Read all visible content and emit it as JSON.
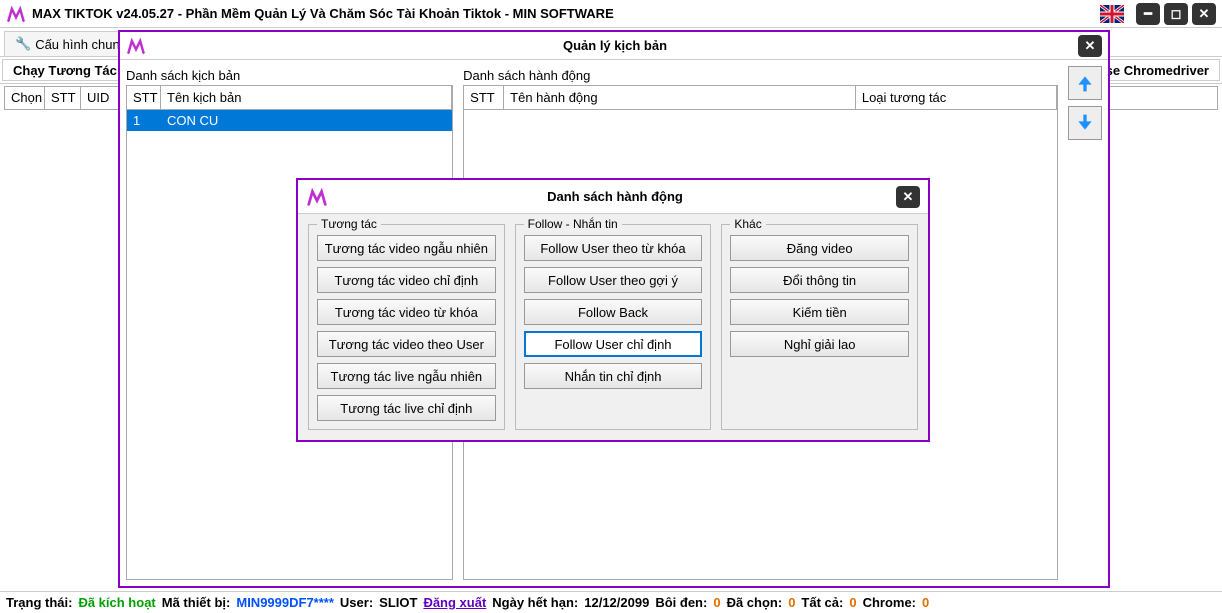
{
  "titlebar": {
    "title": "MAX TIKTOK v24.05.27 - Phần Mềm Quản Lý Và Chăm Sóc Tài Khoản Tiktok - MIN SOFTWARE"
  },
  "tabs": {
    "config": "Cấu hình chung",
    "run": "Chạy Tương Tác",
    "chromedriver": "se Chromedriver"
  },
  "grid": {
    "col_chon": "Chọn",
    "col_stt": "STT",
    "col_uid": "UID"
  },
  "modal1": {
    "title": "Quản lý kịch bản",
    "left_label": "Danh sách kịch bản",
    "right_label": "Danh sách hành động",
    "left_cols": {
      "stt": "STT",
      "name": "Tên kịch bản"
    },
    "right_cols": {
      "stt": "STT",
      "name": "Tên hành động",
      "type": "Loại tương tác"
    },
    "rows": [
      {
        "stt": "1",
        "name": "CON CU"
      }
    ]
  },
  "modal2": {
    "title": "Danh sách hành động",
    "groups": {
      "interact": {
        "legend": "Tương tác",
        "buttons": [
          "Tương tác video ngẫu nhiên",
          "Tương tác video chỉ định",
          "Tương tác video từ khóa",
          "Tương tác video theo User",
          "Tương tác live ngẫu nhiên",
          "Tương tác live chỉ định"
        ]
      },
      "follow": {
        "legend": "Follow - Nhắn tin",
        "buttons": [
          "Follow User theo từ khóa",
          "Follow User theo gợi ý",
          "Follow Back",
          "Follow User chỉ định",
          "Nhắn tin chỉ định"
        ],
        "selected_index": 3
      },
      "other": {
        "legend": "Khác",
        "buttons": [
          "Đăng video",
          "Đổi thông tin",
          "Kiếm tiền",
          "Nghỉ giải lao"
        ]
      }
    }
  },
  "status": {
    "label_status": "Trạng thái:",
    "status_value": "Đã kích hoạt",
    "label_device": "Mã thiết bị:",
    "device_value": "MIN9999DF7****",
    "label_user": "User:",
    "user_value": "SLIOT",
    "logout": "Đăng xuất",
    "label_expire": "Ngày hết hạn:",
    "expire_value": "12/12/2099",
    "label_black": "Bôi đen:",
    "black_value": "0",
    "label_selected": "Đã chọn:",
    "selected_value": "0",
    "label_all": "Tất cả:",
    "all_value": "0",
    "label_chrome": "Chrome:",
    "chrome_value": "0"
  }
}
